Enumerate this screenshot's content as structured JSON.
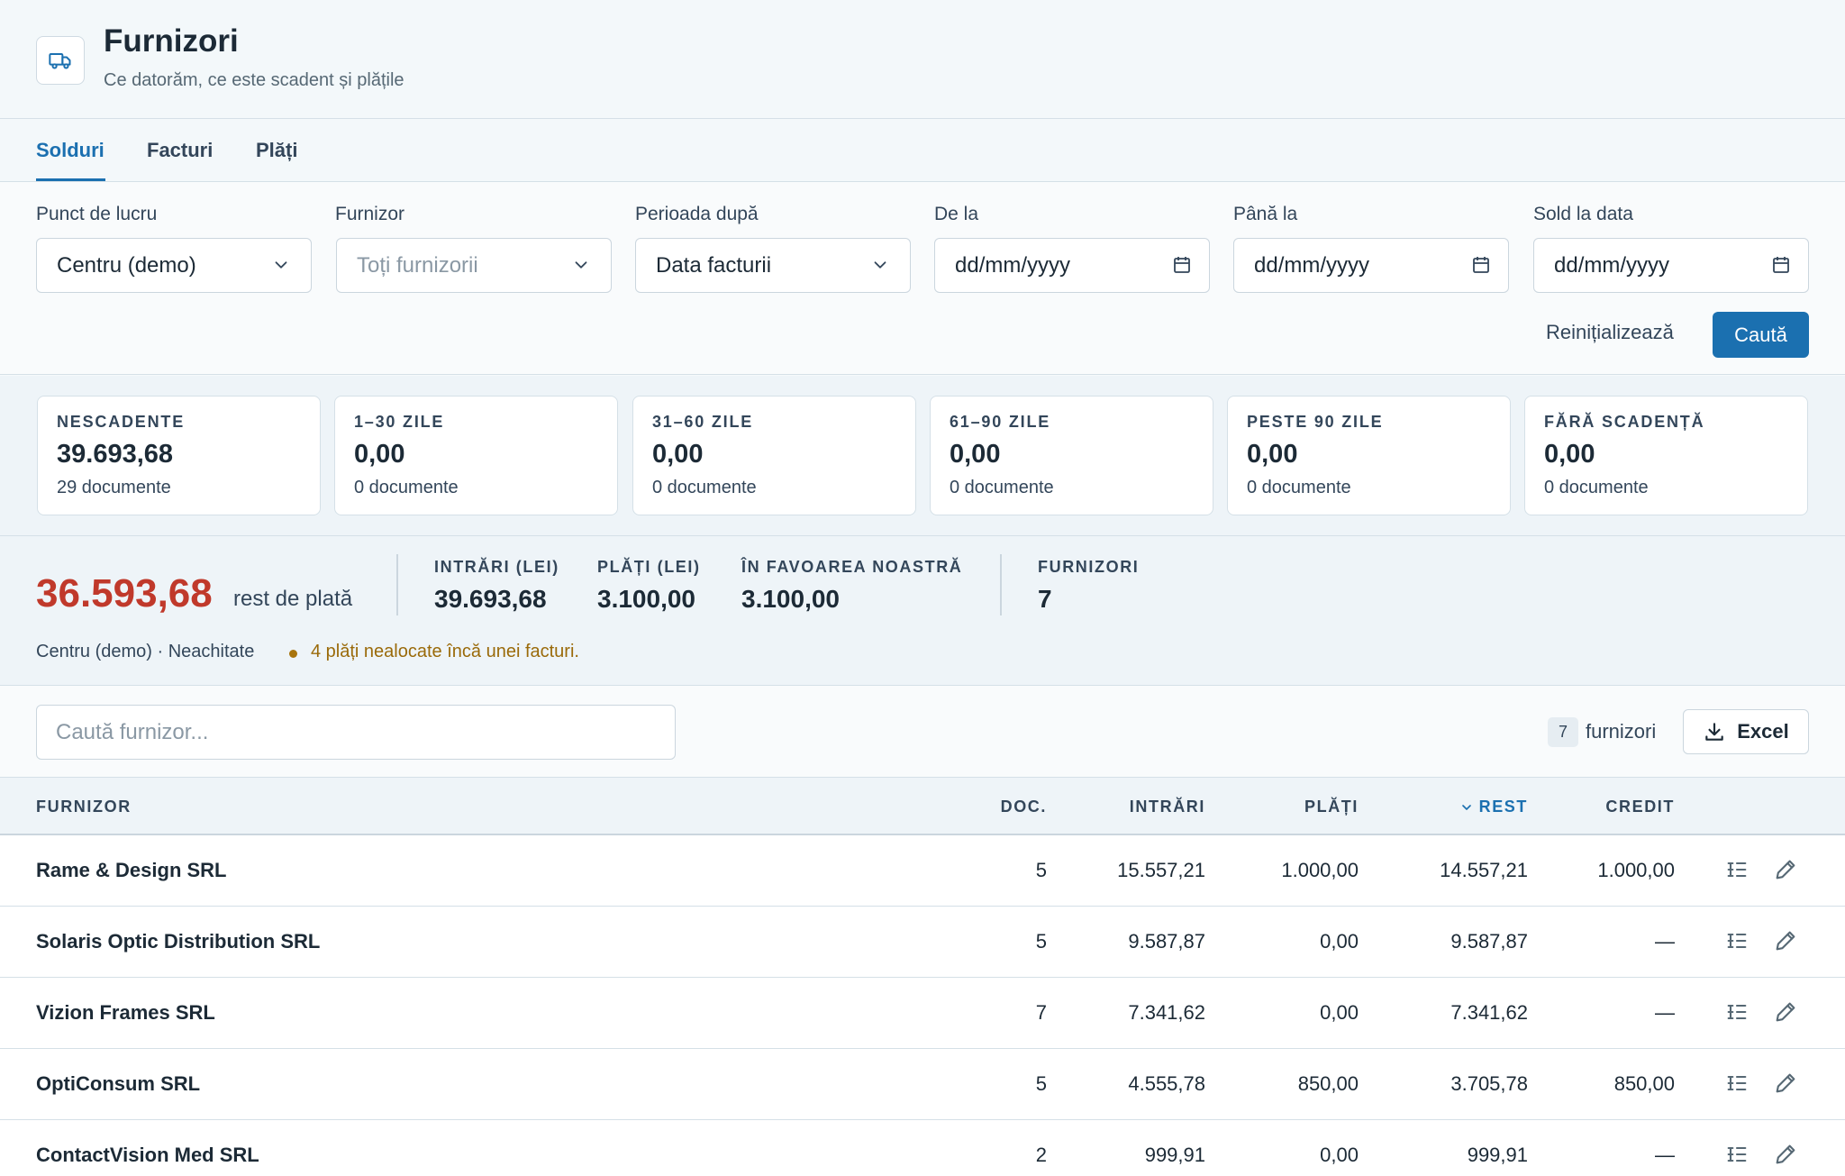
{
  "header": {
    "title": "Furnizori",
    "subtitle": "Ce datorăm, ce este scadent și plățile",
    "icon": "truck-icon"
  },
  "tabs": [
    {
      "label": "Solduri",
      "active": true
    },
    {
      "label": "Facturi",
      "active": false
    },
    {
      "label": "Plăți",
      "active": false
    }
  ],
  "filters": {
    "punct_label": "Punct de lucru",
    "punct_value": "Centru (demo)",
    "furnizor_label": "Furnizor",
    "furnizor_placeholder": "Toți furnizorii",
    "perioada_label": "Perioada după",
    "perioada_value": "Data facturii",
    "de_la_label": "De la",
    "de_la_value": "dd/mm/yyyy",
    "pana_la_label": "Până la",
    "pana_la_value": "dd/mm/yyyy",
    "sold_label": "Sold la data",
    "sold_value": "dd/mm/yyyy",
    "reset_label": "Reinițializează",
    "search_label": "Caută"
  },
  "aging_cards": [
    {
      "label": "NESCADENTE",
      "value": "39.693,68",
      "docs": "29 documente"
    },
    {
      "label": "1–30 ZILE",
      "value": "0,00",
      "docs": "0 documente"
    },
    {
      "label": "31–60 ZILE",
      "value": "0,00",
      "docs": "0 documente"
    },
    {
      "label": "61–90 ZILE",
      "value": "0,00",
      "docs": "0 documente"
    },
    {
      "label": "PESTE 90 ZILE",
      "value": "0,00",
      "docs": "0 documente"
    },
    {
      "label": "FĂRĂ SCADENȚĂ",
      "value": "0,00",
      "docs": "0 documente"
    }
  ],
  "summary": {
    "rest_value": "36.593,68",
    "rest_label": "rest de plată",
    "intrari_label": "INTRĂRI (LEI)",
    "intrari_value": "39.693,68",
    "plati_label": "PLĂȚI (LEI)",
    "plati_value": "3.100,00",
    "favoare_label": "ÎN FAVOAREA NOASTRĂ",
    "favoare_value": "3.100,00",
    "furnizori_label": "FURNIZORI",
    "furnizori_value": "7",
    "context": "Centru (demo) · Neachitate",
    "warning": "4 plăți nealocate încă unei facturi.",
    "rest_color": "#c0392b",
    "warning_color": "#9a6a0a"
  },
  "toolbar": {
    "search_placeholder": "Caută furnizor...",
    "count": "7",
    "count_label": "furnizori",
    "excel_label": "Excel"
  },
  "table": {
    "columns": {
      "furnizor": "FURNIZOR",
      "doc": "DOC.",
      "intrari": "INTRĂRI",
      "plati": "PLĂȚI",
      "rest": "REST",
      "credit": "CREDIT"
    },
    "sorted_by": "rest",
    "rows": [
      {
        "name": "Rame & Design SRL",
        "doc": "5",
        "intrari": "15.557,21",
        "plati": "1.000,00",
        "rest": "14.557,21",
        "credit": "1.000,00"
      },
      {
        "name": "Solaris Optic Distribution SRL",
        "doc": "5",
        "intrari": "9.587,87",
        "plati": "0,00",
        "rest": "9.587,87",
        "credit": "—"
      },
      {
        "name": "Vizion Frames SRL",
        "doc": "7",
        "intrari": "7.341,62",
        "plati": "0,00",
        "rest": "7.341,62",
        "credit": "—"
      },
      {
        "name": "OptiConsum SRL",
        "doc": "5",
        "intrari": "4.555,78",
        "plati": "850,00",
        "rest": "3.705,78",
        "credit": "850,00"
      },
      {
        "name": "ContactVision Med SRL",
        "doc": "2",
        "intrari": "999,91",
        "plati": "0,00",
        "rest": "999,91",
        "credit": "—"
      }
    ]
  },
  "accent_color": "#1b70b0"
}
